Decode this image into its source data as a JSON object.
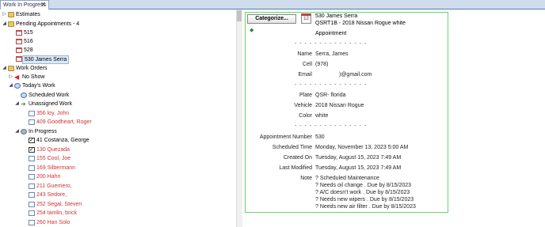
{
  "tab": {
    "label": "Work In Progress",
    "close": "✕"
  },
  "tree": {
    "estimates": "Estimates",
    "pending": "Pending Appointments - 4",
    "appts": [
      "515",
      "516",
      "528",
      "530 James Serra"
    ],
    "work_orders": "Work Orders",
    "no_show": "No Show",
    "todays_work": "Today's Work",
    "scheduled": "Scheduled Work",
    "unassigned": "Unassigned Work",
    "unassigned_items": [
      "356 loy, John",
      "409 Goodheart, Roger"
    ],
    "in_progress": "In Progress",
    "in_progress_items": [
      "41 Costanza, George",
      "130 Quezada",
      "155 Cool, Joe",
      "169 Silbermann",
      "200 Hahn",
      "211 Guerriero,",
      "243 Sedore,",
      "252 Segal, Steven",
      "254 tamlin, brick",
      "260 Han Solo"
    ]
  },
  "details": {
    "categorize_label": "Categorize...",
    "cal_icon_text": "12",
    "title": "530 James Serra",
    "subtitle": "QSRT1B - 2018 Nissan Rogue white",
    "type": "Appointment",
    "divider": "- - - - -    - - - - - - - - - -",
    "fields1": [
      {
        "label": "Name",
        "value": "Serra, James"
      },
      {
        "label": "Cell",
        "value": "(978)"
      },
      {
        "label": "Email",
        "value": ")@gmail.com"
      }
    ],
    "fields2": [
      {
        "label": "Plate",
        "value": "QSR-     florida"
      },
      {
        "label": "Vehicle",
        "value": "2018 Nissan Rogue"
      },
      {
        "label": "Color",
        "value": "white"
      }
    ],
    "fields3": [
      {
        "label": "Appointment Number",
        "value": "530"
      },
      {
        "label": "Scheduled Time",
        "value": "Monday, November 13, 2023 5:00 AM"
      },
      {
        "label": "Created On",
        "value": "Tuesday, August 15, 2023 7:49 AM"
      },
      {
        "label": "Last Modified",
        "value": "Tuesday, August 15, 2023 7:49 AM"
      }
    ],
    "note_label": "Note",
    "note_lines": [
      "? Scheduled Maintenance",
      "? Needs oil change .  Due by 8/15/2023",
      "? A/C doesn't work .  Due by 8/15/2023",
      "? Needs new wipers .  Due by 8/15/2023",
      "? Needs new air filter .  Due by 8/15/2023"
    ]
  },
  "colors": {
    "accent_border": "#6ad26a",
    "red_text": "#cc3333"
  }
}
